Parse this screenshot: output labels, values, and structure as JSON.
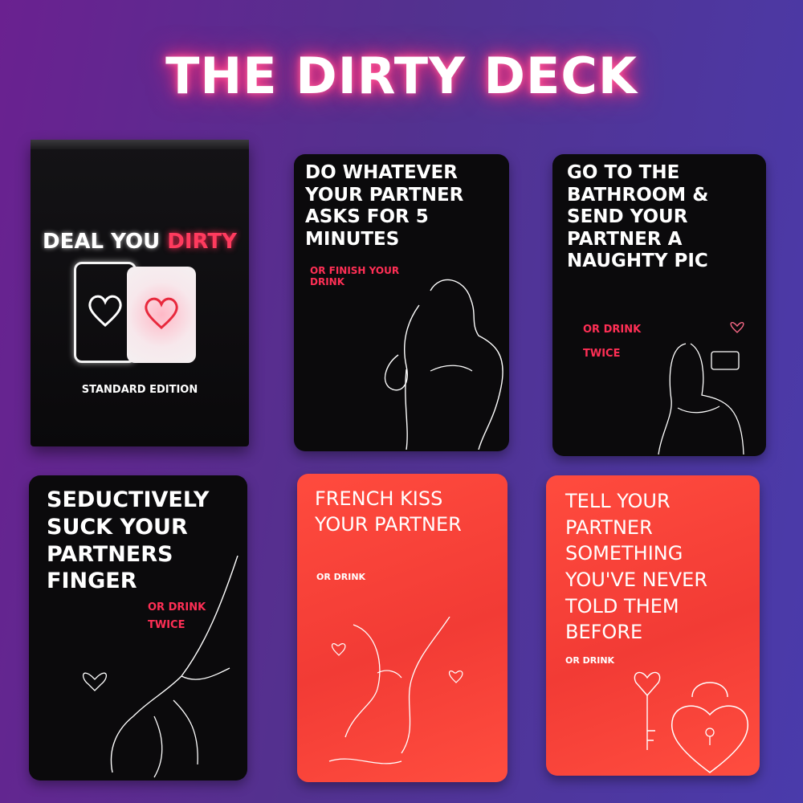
{
  "title": "THE DIRTY DECK",
  "colors": {
    "accent_red": "#ff2f55",
    "card_red": "#f23b35",
    "card_black": "#0b0a0c",
    "glow": "#ff3d86"
  },
  "box": {
    "brand_part1": "DEAL YOU ",
    "brand_part2": "DIRTY",
    "edition": "STANDARD EDITION",
    "icons": [
      "heart-outline-icon",
      "heart-glow-icon"
    ]
  },
  "cards": [
    {
      "color": "black",
      "text": "DO WHATEVER YOUR PARTNER ASKS FOR 5 MINUTES",
      "alt": "OR FINISH YOUR DRINK",
      "art": "torso-line-drawing"
    },
    {
      "color": "black",
      "text": "GO TO THE BATHROOM & SEND YOUR PARTNER A NAUGHTY PIC",
      "alt": "OR DRINK TWICE",
      "art": "selfie-line-drawing"
    },
    {
      "color": "black",
      "text": "SEDUCTIVELY SUCK YOUR PARTNERS FINGER",
      "alt": "OR DRINK TWICE",
      "art": "hand-line-drawing"
    },
    {
      "color": "red",
      "text": "FRENCH KISS YOUR PARTNER",
      "alt": "OR DRINK",
      "art": "kiss-line-drawing"
    },
    {
      "color": "red",
      "text": "TELL YOUR PARTNER SOMETHING YOU'VE NEVER TOLD THEM BEFORE",
      "alt": "OR DRINK",
      "art": "lock-and-key-drawing"
    }
  ]
}
